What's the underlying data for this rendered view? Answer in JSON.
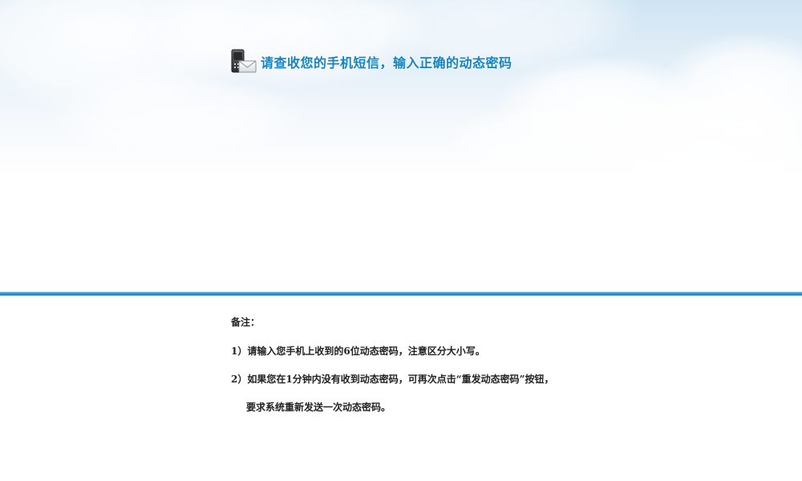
{
  "header": {
    "icon": "phone-envelope-icon",
    "title": "请查收您的手机短信，输入正确的动态密码"
  },
  "notes": {
    "heading": "备注：",
    "items": [
      "1）请输入您手机上收到的6位动态密码，注意区分大小写。",
      "2）如果您在1分钟内没有收到动态密码，可再次点击“重发动态密码”按钮，",
      "要求系统重新发送一次动态密码。"
    ]
  },
  "colors": {
    "title": "#1583c1",
    "divider": "#1a7fc4",
    "sky": "#cfe4f3",
    "note_text": "#222222"
  }
}
